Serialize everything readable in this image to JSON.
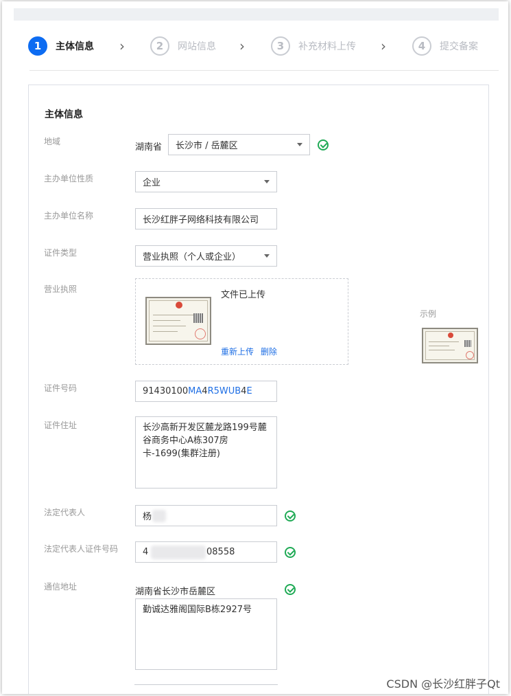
{
  "steps": [
    {
      "num": "1",
      "label": "主体信息",
      "active": true
    },
    {
      "num": "2",
      "label": "网站信息",
      "active": false
    },
    {
      "num": "3",
      "label": "补充材料上传",
      "active": false
    },
    {
      "num": "4",
      "label": "提交备案",
      "active": false
    }
  ],
  "form": {
    "section_title": "主体信息",
    "region": {
      "label": "地域",
      "province": "湖南省",
      "city_district": "长沙市 / 岳麓区"
    },
    "org_type": {
      "label": "主办单位性质",
      "value": "企业"
    },
    "org_name": {
      "label": "主办单位名称",
      "value": "长沙红胖子网络科技有限公司"
    },
    "cert_type": {
      "label": "证件类型",
      "value": "营业执照（个人或企业）"
    },
    "license": {
      "label": "营业执照",
      "status": "文件已上传",
      "reupload": "重新上传",
      "delete": "删除",
      "example_label": "示例"
    },
    "cert_number": {
      "label": "证件号码",
      "parts": [
        "91430100",
        "MA",
        "4",
        "R5",
        "WUB",
        "4",
        "E"
      ]
    },
    "cert_address": {
      "label": "证件住址",
      "value": "长沙高新开发区麓龙路199号麓谷商务中心A栋307房卡-1699(集群注册)"
    },
    "legal_rep": {
      "label": "法定代表人",
      "value_visible": "杨"
    },
    "legal_rep_id": {
      "label": "法定代表人证件号码",
      "value_visible": "4",
      "value_tail": "08558"
    },
    "mail_address": {
      "label": "通信地址",
      "region": "湖南省长沙市岳麓区",
      "detail": "勤诚达雅阁国际B栋2927号"
    }
  },
  "watermark": "CSDN @长沙红胖子Qt"
}
